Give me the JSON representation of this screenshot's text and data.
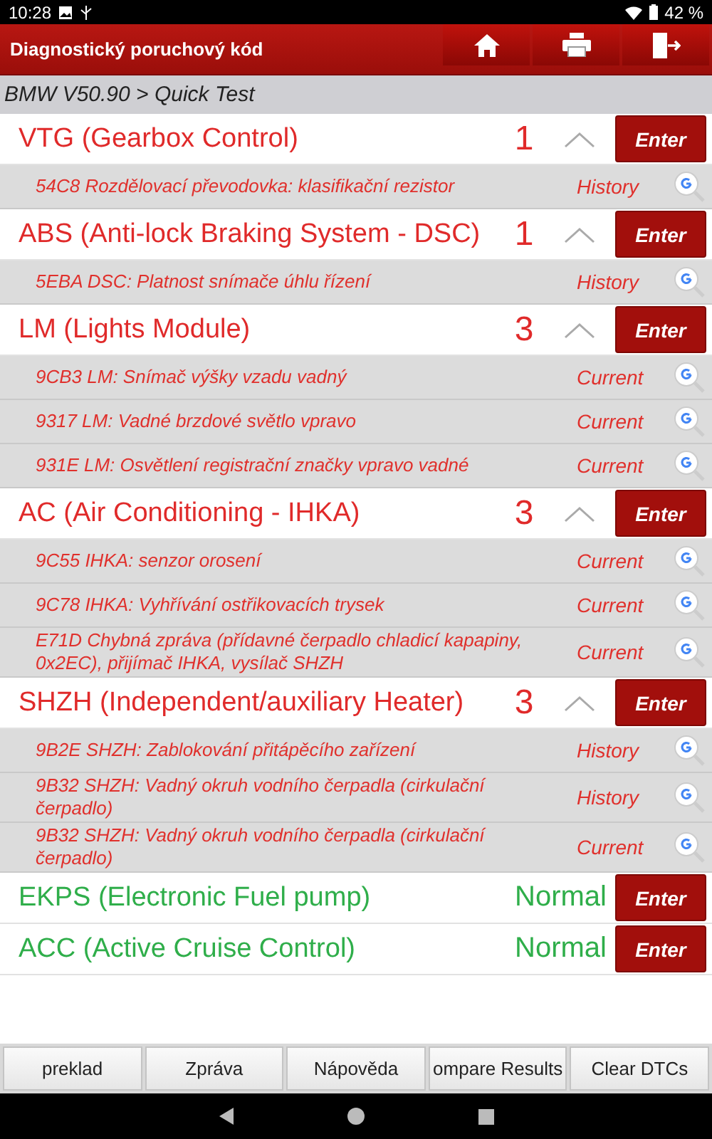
{
  "status_bar": {
    "time": "10:28",
    "battery": "42 %"
  },
  "header": {
    "title": "Diagnostický poruchový kód"
  },
  "breadcrumb": "BMW V50.90 > Quick Test",
  "modules": [
    {
      "kind": "fault",
      "name": "VTG (Gearbox Control)",
      "count": "1",
      "expanded": true,
      "button": "Enter",
      "faults": [
        {
          "text": "54C8 Rozdělovací převodovka: klasifikační rezistor",
          "state": "History"
        }
      ]
    },
    {
      "kind": "fault",
      "name": "ABS (Anti-lock Braking System - DSC)",
      "count": "1",
      "expanded": true,
      "button": "Enter",
      "faults": [
        {
          "text": "5EBA DSC: Platnost snímače úhlu řízení",
          "state": "History"
        }
      ]
    },
    {
      "kind": "fault",
      "name": "LM (Lights Module)",
      "count": "3",
      "expanded": true,
      "button": "Enter",
      "faults": [
        {
          "text": "9CB3 LM: Snímač výšky vzadu vadný",
          "state": "Current"
        },
        {
          "text": "9317 LM: Vadné brzdové světlo vpravo",
          "state": "Current"
        },
        {
          "text": "931E LM: Osvětlení registrační značky vpravo vadné",
          "state": "Current"
        }
      ]
    },
    {
      "kind": "fault",
      "name": "AC (Air Conditioning - IHKA)",
      "count": "3",
      "expanded": true,
      "button": "Enter",
      "faults": [
        {
          "text": "9C55 IHKA: senzor orosení",
          "state": "Current"
        },
        {
          "text": "9C78 IHKA: Vyhřívání ostřikovacích trysek",
          "state": "Current"
        },
        {
          "text": "E71D Chybná zpráva (přídavné čerpadlo chladicí kapapiny, 0x2EC), přijímač IHKA, vysílač SHZH",
          "state": "Current"
        }
      ]
    },
    {
      "kind": "fault",
      "name": "SHZH (Independent/auxiliary Heater)",
      "count": "3",
      "expanded": true,
      "button": "Enter",
      "faults": [
        {
          "text": "9B2E SHZH: Zablokování přitápěcího zařízení",
          "state": "History"
        },
        {
          "text": "9B32 SHZH: Vadný okruh vodního čerpadla (cirkulační čerpadlo)",
          "state": "History"
        },
        {
          "text": "9B32 SHZH: Vadný okruh vodního čerpadla (cirkulační čerpadlo)",
          "state": "Current"
        }
      ]
    },
    {
      "kind": "normal",
      "name": "EKPS (Electronic Fuel pump)",
      "status": "Normal",
      "button": "Enter"
    },
    {
      "kind": "normal",
      "name": "ACC (Active Cruise Control)",
      "status": "Normal",
      "button": "Enter"
    }
  ],
  "toolbar": [
    "preklad",
    "Zpráva",
    "Nápověda",
    "ompare Results",
    "Clear DTCs"
  ]
}
